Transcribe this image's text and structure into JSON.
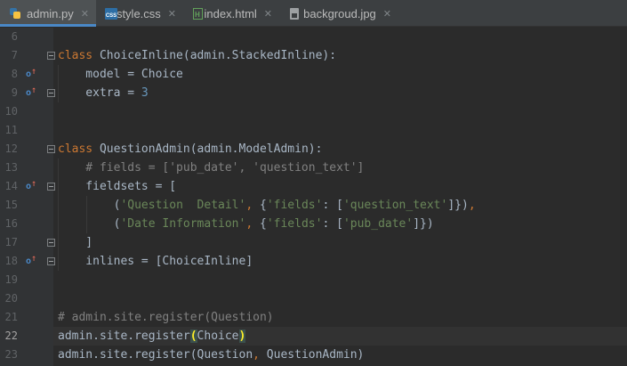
{
  "tabs": [
    {
      "label": "admin.py",
      "icon": "python-file-icon",
      "active": true
    },
    {
      "label": "style.css",
      "icon": "css-file-icon",
      "active": false
    },
    {
      "label": "index.html",
      "icon": "html-file-icon",
      "active": false
    },
    {
      "label": "backgroud.jpg",
      "icon": "image-file-icon",
      "active": false
    }
  ],
  "close_glyph": "✕",
  "gutter": {
    "line_numbers": [
      "6",
      "7",
      "8",
      "9",
      "10",
      "11",
      "12",
      "13",
      "14",
      "15",
      "16",
      "17",
      "18",
      "19",
      "20",
      "21",
      "22",
      "23"
    ],
    "override_marker": "o",
    "override_arrow": "↑",
    "current_line": "22"
  },
  "code": {
    "l7": {
      "kw": "class",
      "rest": " ChoiceInline(admin.StackedInline):"
    },
    "l8": {
      "text": "    model = Choice"
    },
    "l9": {
      "text": "    extra = ",
      "num": "3"
    },
    "l12": {
      "kw": "class",
      "rest": " QuestionAdmin(admin.ModelAdmin):"
    },
    "l13": {
      "comment": "    # fields = ['pub_date', 'question_text']"
    },
    "l14": {
      "text": "    fieldsets = ["
    },
    "l15": {
      "p1": "        (",
      "s1": "'Question  Detail'",
      "c1": ",",
      "p2": " {",
      "s2": "'fields'",
      "p3": ": [",
      "s3": "'question_text'",
      "p4": "]})",
      "c2": ","
    },
    "l16": {
      "p1": "        (",
      "s1": "'Date Information'",
      "c1": ",",
      "p2": " {",
      "s2": "'fields'",
      "p3": ": [",
      "s3": "'pub_date'",
      "p4": "]})"
    },
    "l17": {
      "text": "    ]"
    },
    "l18": {
      "text": "    inlines = [ChoiceInline]"
    },
    "l21": {
      "comment": "# admin.site.register(Question)"
    },
    "l22": {
      "pre": "admin.site.register",
      "open": "(",
      "mid": "Choice",
      "close": ")"
    },
    "l23": {
      "pre": "admin.site.register(Question",
      "comma": ",",
      "post": " QuestionAdmin)"
    }
  },
  "colors": {
    "background": "#2b2b2b",
    "keyword": "#cc7832",
    "string": "#6a8759",
    "number": "#6897bb",
    "comment": "#808080",
    "default_text": "#a9b7c6",
    "active_tab_underline": "#4a88c7"
  }
}
